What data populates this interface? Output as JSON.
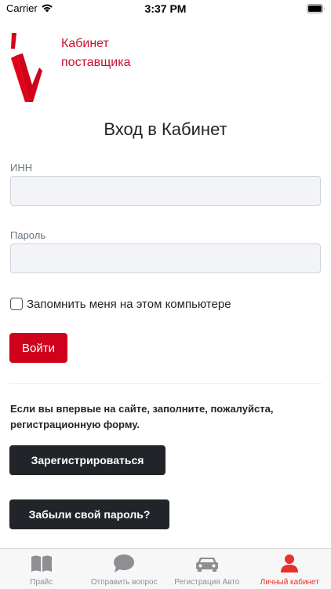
{
  "status_bar": {
    "carrier": "Carrier",
    "time": "3:37 PM"
  },
  "brand": {
    "title_line1": "Кабинет",
    "title_line2": "поставщика",
    "color": "#c8102e"
  },
  "login": {
    "title": "Вход в Кабинет",
    "inn_label": "ИНН",
    "inn_value": "",
    "password_label": "Пароль",
    "password_value": "",
    "remember_label": "Запомнить меня на этом компьютере",
    "remember_checked": false,
    "submit_label": "Войти",
    "submit_color": "#d0021b"
  },
  "registration": {
    "info": "Если вы впервые на сайте, заполните, пожалуйста, регистрационную форму.",
    "register_label": "Зарегистрироваться",
    "forgot_label": "Забыли свой пароль?"
  },
  "tab_bar": {
    "active_color": "#e8302e",
    "inactive_color": "#8e8e93",
    "tabs": [
      {
        "label": "Прайс",
        "icon": "book-icon"
      },
      {
        "label": "Отправить вопрос",
        "icon": "chat-bubble-icon"
      },
      {
        "label": "Регистрация Авто",
        "icon": "car-icon"
      },
      {
        "label": "Личный кабинет",
        "icon": "person-icon",
        "active": true
      }
    ]
  }
}
